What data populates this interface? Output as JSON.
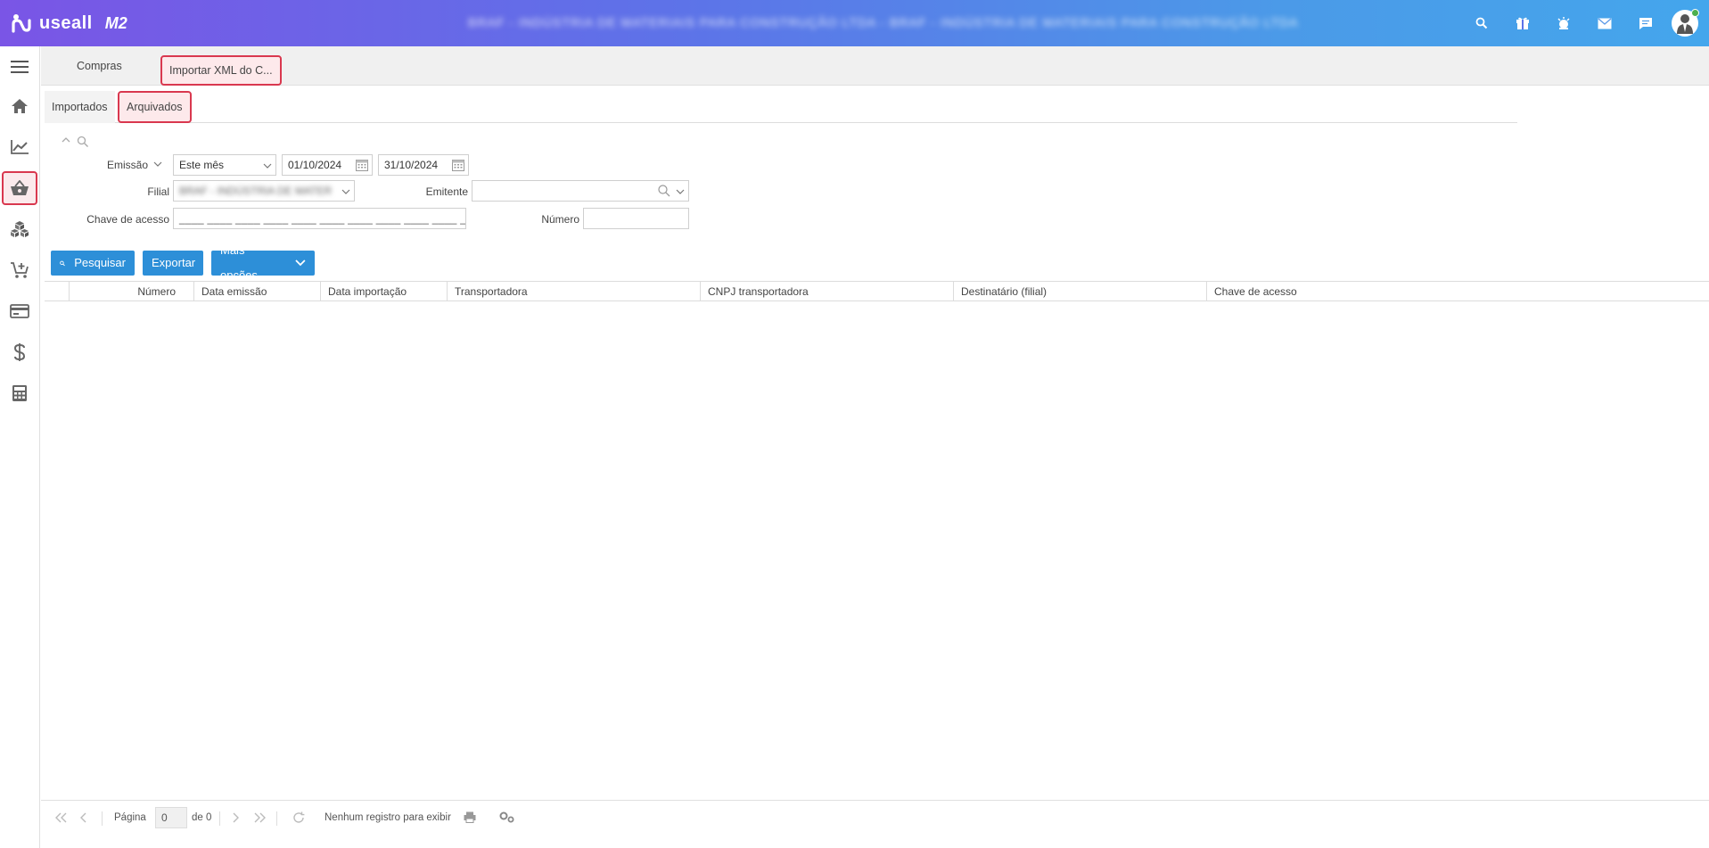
{
  "header": {
    "logo_text": "useall",
    "logo_suffix": "M2",
    "company_name": "BRAF - INDÚSTRIA DE MATERIAIS PARA CONSTRUÇÃO LTDA - BRAF - INDÚSTRIA DE MATERIAIS PARA CONSTRUÇÃO LTDA",
    "icons": [
      "search-icon",
      "gift-icon",
      "alarm-icon",
      "mail-icon",
      "chat-icon"
    ]
  },
  "sidebar": {
    "items": [
      "menu-icon",
      "home-icon",
      "chart-icon",
      "basket-icon",
      "boxes-icon",
      "cart-icon",
      "card-icon",
      "dollar-icon",
      "calculator-icon"
    ],
    "active": "basket-icon"
  },
  "module_tabs": [
    {
      "label": "Compras"
    },
    {
      "label": "Importar XML do C..."
    }
  ],
  "sub_tabs": [
    {
      "label": "Importados"
    },
    {
      "label": "Arquivados"
    }
  ],
  "filter": {
    "emissao_label": "Emissão",
    "emissao_value": "Este mês",
    "date_from": "01/10/2024",
    "date_to": "31/10/2024",
    "filial_label": "Filial",
    "filial_value": "BRAF - INDÚSTRIA DE MATER",
    "emitente_label": "Emitente",
    "emitente_value": "",
    "chave_label": "Chave de acesso",
    "chave_placeholder": "____ ____ ____ ____ ____ ____ ____ ____ ____ ____ ____",
    "numero_label": "Número",
    "numero_value": ""
  },
  "actions": {
    "search_label": "Pesquisar",
    "export_label": "Exportar",
    "more_label": "Mais opções"
  },
  "grid": {
    "columns": [
      "Número",
      "Data emissão",
      "Data importação",
      "Transportadora",
      "CNPJ transportadora",
      "Destinatário (filial)",
      "Chave de acesso"
    ],
    "rows": []
  },
  "pager": {
    "page_label": "Página",
    "page_value": "0",
    "of_label": "de 0",
    "status": "Nenhum registro para exibir"
  },
  "colors": {
    "accent": "#2d8fd8",
    "highlight_border": "#d9384f",
    "header_gradient_start": "#7a55e6",
    "header_gradient_end": "#44a6ec"
  }
}
